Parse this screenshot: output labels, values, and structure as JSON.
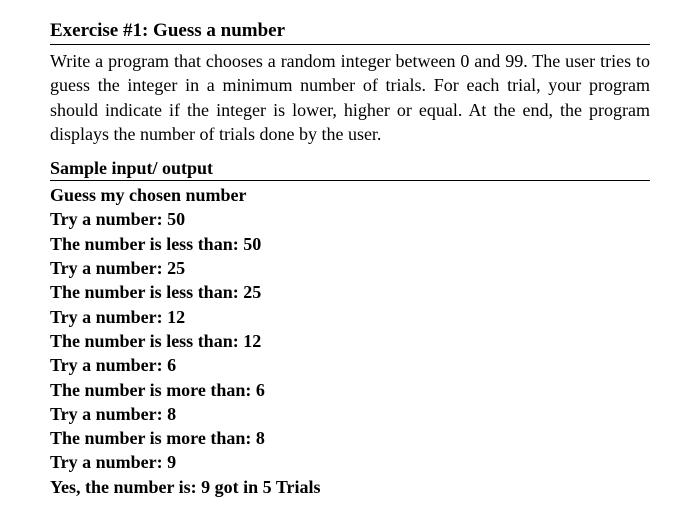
{
  "title": "Exercise #1: Guess a number",
  "description": "Write a program that chooses a random integer between 0 and 99. The user tries to guess the integer in a minimum number of trials. For each trial, your program should indicate if the integer is lower, higher or equal. At the end, the program displays the number of trials done by the user.",
  "subheading": "Sample input/ output",
  "sample": {
    "l0": "Guess my chosen number",
    "l1": "Try a number: 50",
    "l2": "The number is less than: 50",
    "l3": "Try a number: 25",
    "l4": "The number is less than: 25",
    "l5": "Try a number: 12",
    "l6": "The number is less than: 12",
    "l7": "Try a number: 6",
    "l8": "The number is more than: 6",
    "l9": "Try a number: 8",
    "l10": "The number is more than: 8",
    "l11": "Try a number: 9",
    "l12": "Yes, the number is: 9 got in 5 Trials"
  }
}
